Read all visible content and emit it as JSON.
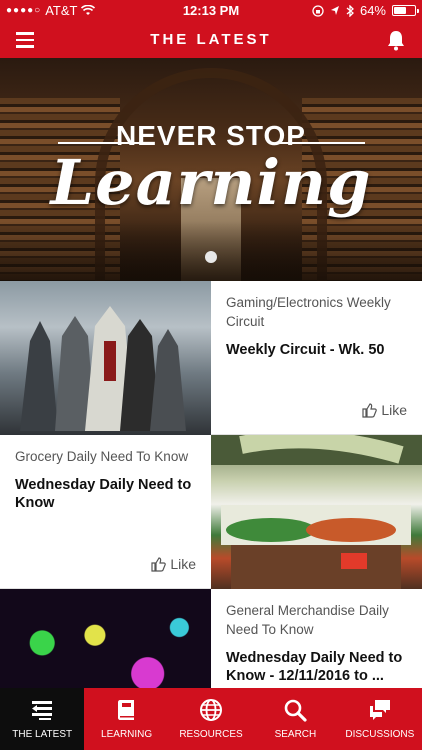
{
  "status_bar": {
    "carrier": "AT&T",
    "time": "12:13 PM",
    "battery_percent": "64%",
    "battery_level": 0.64,
    "icons": [
      "signal-dots-icon",
      "wifi-icon",
      "lock-rotation-icon",
      "location-icon",
      "bluetooth-icon",
      "battery-icon"
    ]
  },
  "header": {
    "title": "THE LATEST",
    "menu_icon": "hamburger-menu-icon",
    "bell_icon": "bell-icon"
  },
  "hero": {
    "tagline": "NEVER STOP",
    "script": "Learning",
    "carousel_active_index": 0
  },
  "feed": {
    "items": [
      {
        "category": "Gaming/Electronics Weekly Circuit",
        "headline": "Weekly Circuit - Wk. 50",
        "like_label": "Like",
        "image": "assassins-creed-characters"
      },
      {
        "category": "Grocery Daily Need To Know",
        "headline": "Wednesday Daily Need to Know",
        "like_label": "Like",
        "image": "produce-department"
      },
      {
        "category": "General Merchandise Daily Need To Know",
        "headline": "Wednesday Daily Need to Know - 12/11/2016 to ...",
        "image": "colorful-bokeh-lights"
      }
    ]
  },
  "bottom_nav": {
    "items": [
      {
        "label": "THE LATEST",
        "icon": "latest-icon",
        "active": true
      },
      {
        "label": "LEARNING",
        "icon": "book-icon",
        "active": false
      },
      {
        "label": "RESOURCES",
        "icon": "globe-icon",
        "active": false
      },
      {
        "label": "SEARCH",
        "icon": "search-icon",
        "active": false
      },
      {
        "label": "DISCUSSIONS",
        "icon": "chat-bubbles-icon",
        "active": false
      }
    ]
  },
  "colors": {
    "brand_red": "#d0101e",
    "active_nav_bg": "#0d0d0d",
    "text_dark": "#111111",
    "text_muted": "#555555"
  }
}
